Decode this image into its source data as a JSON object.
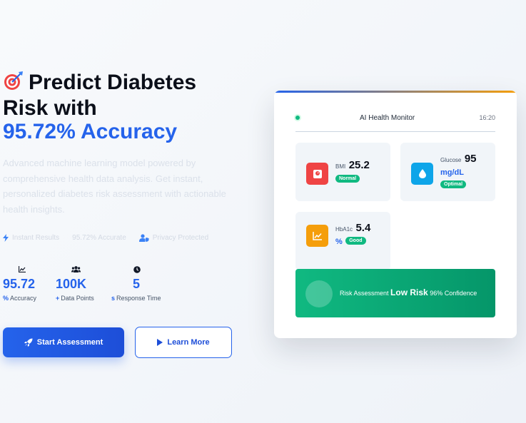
{
  "hero": {
    "title_line1": "Predict Diabetes",
    "title_line2": "Risk with",
    "title_accent": "95.72% Accuracy",
    "subtitle": "Advanced machine learning model powered by comprehensive health data analysis. Get instant, personalized diabetes risk assessment with actionable health insights."
  },
  "features": [
    {
      "label": "Instant Results",
      "icon": "bolt-icon"
    },
    {
      "label": "95.72% Accurate",
      "icon": "none"
    },
    {
      "label": "Privacy Protected",
      "icon": "user-shield-icon"
    }
  ],
  "stats": [
    {
      "value": "95.72",
      "prefix": "%",
      "label": "Accuracy",
      "icon": "chart-line-icon"
    },
    {
      "value": "100K",
      "prefix": "+",
      "label": "Data Points",
      "icon": "users-icon"
    },
    {
      "value": "5",
      "prefix": "s",
      "label": "Response Time",
      "icon": "clock-icon"
    }
  ],
  "buttons": {
    "start": "Start Assessment",
    "learn": "Learn More"
  },
  "monitor": {
    "title": "AI Health Monitor",
    "time": "16:20",
    "metrics": [
      {
        "label": "BMI",
        "value": "25.2",
        "unit": "",
        "badge": "Normal",
        "icon": "weight-scale-icon",
        "color": "#ef4444"
      },
      {
        "label": "Glucose",
        "value": "95",
        "unit": "mg/dL",
        "badge": "Optimal",
        "icon": "droplet-icon",
        "color": "#0ea5e9"
      },
      {
        "label": "HbA1c",
        "value": "5.4",
        "unit": "%",
        "badge": "Good",
        "icon": "chart-line-icon",
        "color": "#f59e0b"
      }
    ],
    "risk": {
      "label": "Risk Assessment",
      "level": "Low Risk",
      "confidence": "96% Confidence"
    }
  },
  "colors": {
    "accent": "#2563eb",
    "success": "#10b981"
  }
}
